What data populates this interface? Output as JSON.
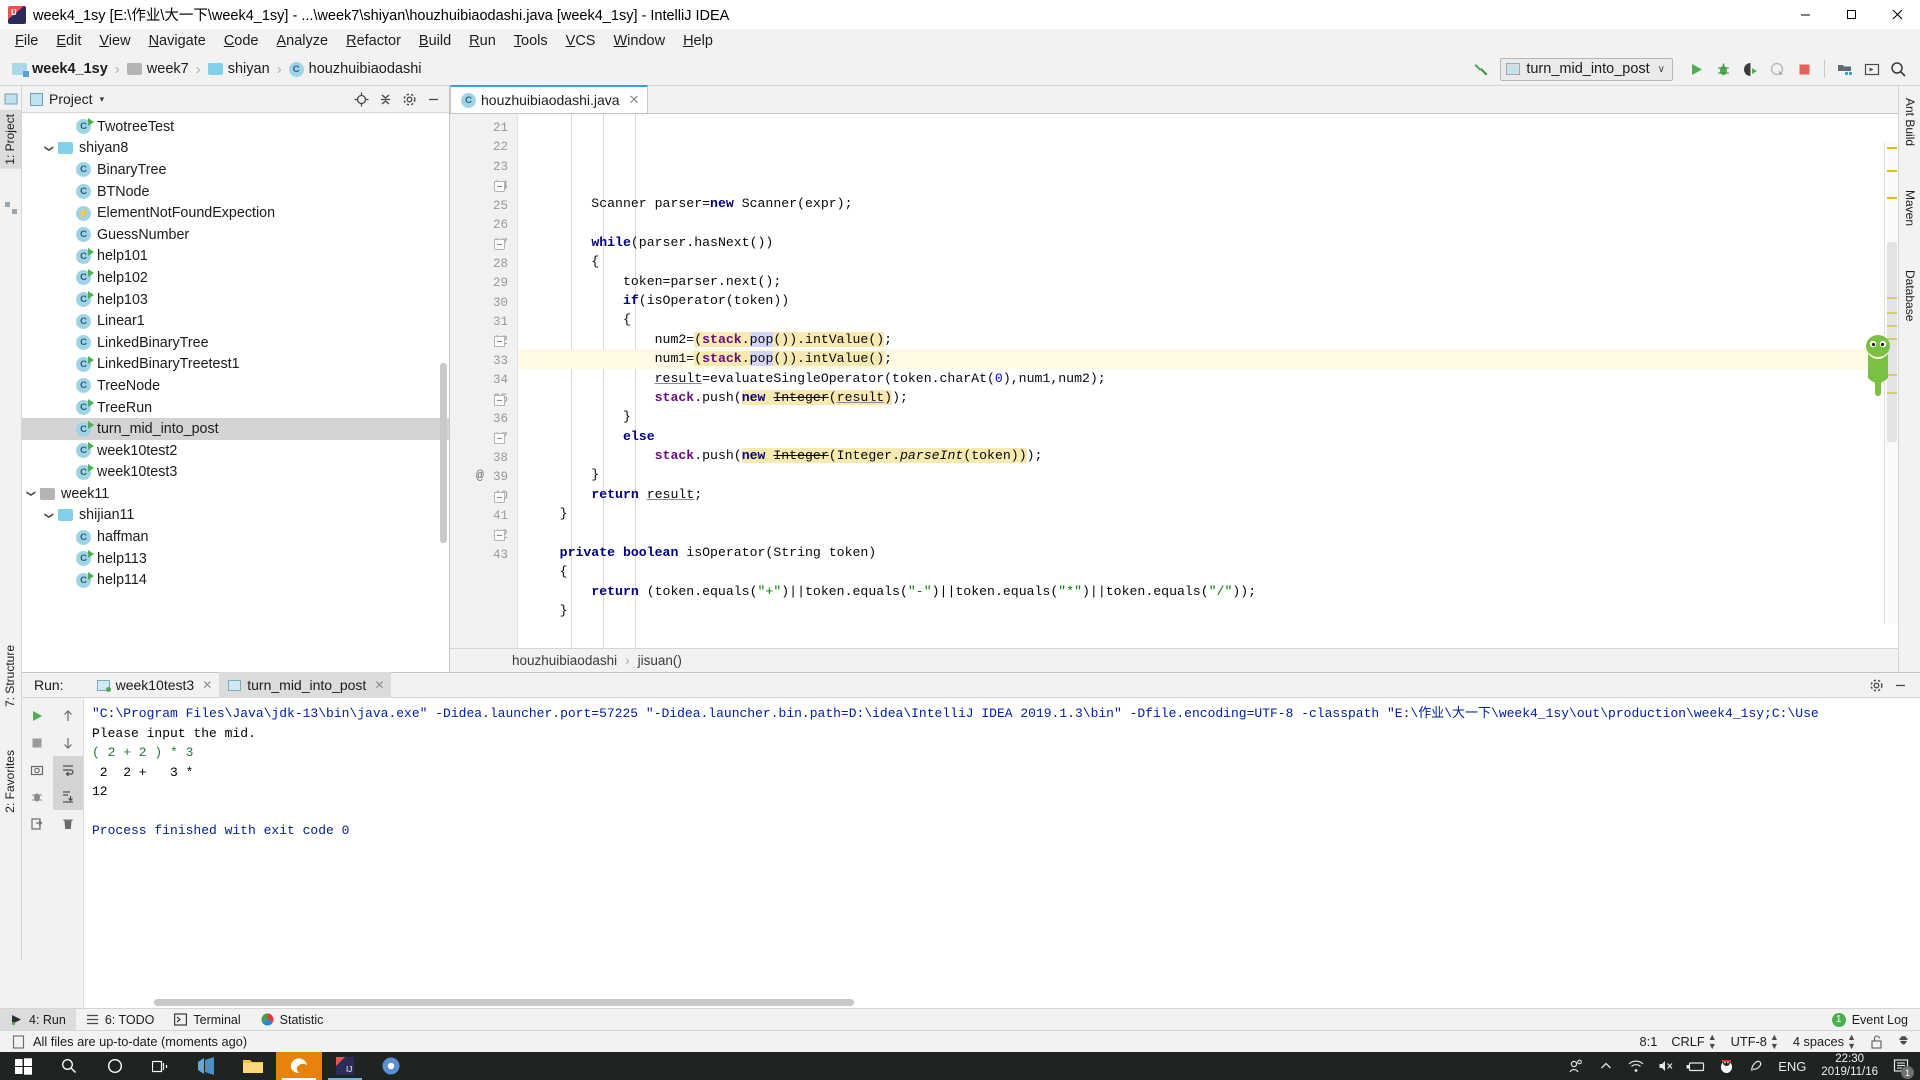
{
  "window": {
    "title": "week4_1sy [E:\\作业\\大一下\\week4_1sy] - ...\\week7\\shiyan\\houzhuibiaodashi.java [week4_1sy] - IntelliJ IDEA",
    "minimize_label": "—",
    "maximize_label": "☐",
    "close_label": "✕"
  },
  "menu": [
    {
      "label": "File"
    },
    {
      "label": "Edit"
    },
    {
      "label": "View"
    },
    {
      "label": "Navigate"
    },
    {
      "label": "Code"
    },
    {
      "label": "Analyze"
    },
    {
      "label": "Refactor"
    },
    {
      "label": "Build"
    },
    {
      "label": "Run"
    },
    {
      "label": "Tools"
    },
    {
      "label": "VCS"
    },
    {
      "label": "Window"
    },
    {
      "label": "Help"
    }
  ],
  "breadcrumbs": [
    {
      "label": "week4_1sy",
      "icon": "module-folder-icon",
      "bold": true
    },
    {
      "label": "week7",
      "icon": "folder-grey-icon",
      "bold": false
    },
    {
      "label": "shiyan",
      "icon": "folder-blue-icon",
      "bold": false
    },
    {
      "label": "houzhuibiaodashi",
      "icon": "java-class-icon",
      "bold": false
    }
  ],
  "toolbar": {
    "build_icon": "hammer-icon",
    "run_config": "turn_mid_into_post",
    "run_config_icon": "application-config-icon",
    "dropdown_arrow": "∨",
    "buttons": [
      {
        "name": "run-button",
        "icon": "play-icon"
      },
      {
        "name": "debug-button",
        "icon": "bug-icon"
      },
      {
        "name": "run-with-coverage-button",
        "icon": "coverage-icon"
      },
      {
        "name": "profile-button",
        "icon": "profile-icon"
      },
      {
        "name": "stop-button",
        "icon": "stop-square-icon"
      },
      {
        "name": "project-structure-button",
        "icon": "project-structure-icon"
      },
      {
        "name": "select-opened-file-button",
        "icon": "terminal-box-icon"
      },
      {
        "name": "search-everywhere-button",
        "icon": "search-icon"
      }
    ]
  },
  "left_strip": [
    {
      "label": "1: Project",
      "selected": true
    },
    {
      "label": "7: Structure",
      "selected": false
    },
    {
      "label": "2: Favorites",
      "selected": false
    }
  ],
  "right_strip": [
    {
      "label": "Ant Build"
    },
    {
      "label": "Maven"
    },
    {
      "label": "Database"
    }
  ],
  "project_panel": {
    "title": "Project",
    "caret": "▾",
    "actions": [
      "locate-icon",
      "collapse-all-icon",
      "settings-gear-icon",
      "hide-icon"
    ],
    "tree": [
      {
        "label": "TwotreeTest",
        "depth": 3,
        "icon": "class-runnable-icon",
        "twisty": "",
        "selected": false
      },
      {
        "label": "shiyan8",
        "depth": 2,
        "icon": "folder-blue-icon",
        "twisty": "v",
        "selected": false
      },
      {
        "label": "BinaryTree",
        "depth": 3,
        "icon": "class-icon",
        "twisty": "",
        "selected": false
      },
      {
        "label": "BTNode",
        "depth": 3,
        "icon": "class-icon",
        "twisty": "",
        "selected": false
      },
      {
        "label": "ElementNotFoundExpection",
        "depth": 3,
        "icon": "exception-class-icon",
        "twisty": "",
        "selected": false
      },
      {
        "label": "GuessNumber",
        "depth": 3,
        "icon": "class-icon",
        "twisty": "",
        "selected": false
      },
      {
        "label": "help101",
        "depth": 3,
        "icon": "class-runnable-icon",
        "twisty": "",
        "selected": false
      },
      {
        "label": "help102",
        "depth": 3,
        "icon": "class-runnable-icon",
        "twisty": "",
        "selected": false
      },
      {
        "label": "help103",
        "depth": 3,
        "icon": "class-runnable-icon",
        "twisty": "",
        "selected": false
      },
      {
        "label": "Linear1",
        "depth": 3,
        "icon": "class-icon",
        "twisty": "",
        "selected": false
      },
      {
        "label": "LinkedBinaryTree",
        "depth": 3,
        "icon": "class-icon",
        "twisty": "",
        "selected": false
      },
      {
        "label": "LinkedBinaryTreetest1",
        "depth": 3,
        "icon": "class-runnable-icon",
        "twisty": "",
        "selected": false
      },
      {
        "label": "TreeNode",
        "depth": 3,
        "icon": "class-icon",
        "twisty": "",
        "selected": false
      },
      {
        "label": "TreeRun",
        "depth": 3,
        "icon": "class-runnable-icon",
        "twisty": "",
        "selected": false
      },
      {
        "label": "turn_mid_into_post",
        "depth": 3,
        "icon": "class-runnable-icon",
        "twisty": "",
        "selected": true
      },
      {
        "label": "week10test2",
        "depth": 3,
        "icon": "class-runnable-icon",
        "twisty": "",
        "selected": false
      },
      {
        "label": "week10test3",
        "depth": 3,
        "icon": "class-runnable-icon",
        "twisty": "",
        "selected": false
      },
      {
        "label": "week11",
        "depth": 1,
        "icon": "folder-grey-icon",
        "twisty": "v",
        "selected": false
      },
      {
        "label": "shijian11",
        "depth": 2,
        "icon": "folder-blue-icon",
        "twisty": "v",
        "selected": false
      },
      {
        "label": "haffman",
        "depth": 3,
        "icon": "class-icon",
        "twisty": "",
        "selected": false
      },
      {
        "label": "help113",
        "depth": 3,
        "icon": "class-runnable-icon",
        "twisty": "",
        "selected": false
      },
      {
        "label": "help114",
        "depth": 3,
        "icon": "class-runnable-icon",
        "twisty": "",
        "selected": false
      }
    ]
  },
  "editor": {
    "tab": {
      "label": "houzhuibiaodashi.java",
      "icon": "java-class-icon",
      "close": "✕"
    },
    "first_line_number": 21,
    "current_line": 29,
    "lines": [
      {
        "n": 21,
        "html": "        Scanner parser=<span class=\"kw\">new</span> Scanner(expr);"
      },
      {
        "n": 22,
        "html": ""
      },
      {
        "n": 23,
        "html": "        <span class=\"kw\">while</span>(parser.hasNext())"
      },
      {
        "n": 24,
        "html": "        {",
        "fold": "down"
      },
      {
        "n": 25,
        "html": "            token=parser.next();"
      },
      {
        "n": 26,
        "html": "            <span class=\"kw\">if</span>(isOperator(token))"
      },
      {
        "n": 27,
        "html": "            {",
        "fold": "down"
      },
      {
        "n": 28,
        "html": "                num2=<span class=\"hl\">(<span class=\"fld\">stack</span>.</span><span class=\"hl2\">pop</span><span class=\"hl\">()).intValue()</span>;"
      },
      {
        "n": 29,
        "html": "                num1=<span class=\"hl\">(<span class=\"fld\">stack</span>.</span><span class=\"hl2\">pop</span><span class=\"hl\">()).intValue()</span>;"
      },
      {
        "n": 30,
        "html": "                <span class=\"und\">result</span>=evaluateSingleOperator(token.charAt(<span class=\"num\">0</span>),num1,num2);"
      },
      {
        "n": 31,
        "html": "                <span class=\"fld\">stack</span>.push(<span class=\"hl\"><span class=\"kw\">new</span> <span class=\"strike\">Integer</span>(<span class=\"und\">result</span>)</span>);"
      },
      {
        "n": 32,
        "html": "            }",
        "fold": "up"
      },
      {
        "n": 33,
        "html": "            <span class=\"kw\">else</span>"
      },
      {
        "n": 34,
        "html": "                <span class=\"fld\">stack</span>.push(<span class=\"hl\"><span class=\"kw\">new</span> <span class=\"strike\">Integer</span>(Integer.<span class=\"ital\">parseInt</span>(token))</span>);"
      },
      {
        "n": 35,
        "html": "        }",
        "fold": "up"
      },
      {
        "n": 36,
        "html": "        <span class=\"kw\">return</span> <span class=\"und\">result</span>;"
      },
      {
        "n": 37,
        "html": "    }",
        "fold": "up"
      },
      {
        "n": 38,
        "html": ""
      },
      {
        "n": 39,
        "html": "    <span class=\"kw\">private boolean</span> isOperator(String token)",
        "at": true
      },
      {
        "n": 40,
        "html": "    {",
        "fold": "down"
      },
      {
        "n": 41,
        "html": "        <span class=\"kw\">return</span> (token.equals(<span class=\"str\">\"+\"</span>)||token.equals(<span class=\"str\">\"-\"</span>)||token.equals(<span class=\"str\">\"*\"</span>)||token.equals(<span class=\"str\">\"/\"</span>));"
      },
      {
        "n": 42,
        "html": "    }",
        "fold": "up"
      },
      {
        "n": 43,
        "html": ""
      }
    ],
    "status_breadcrumb": [
      "houzhuibiaodashi",
      "jisuan()"
    ],
    "breadcrumb_sep": "›"
  },
  "run_panel": {
    "label": "Run:",
    "tabs": [
      {
        "label": "week10test3",
        "active": false,
        "close": "✕",
        "running": true
      },
      {
        "label": "turn_mid_into_post",
        "active": true,
        "close": "✕",
        "running": false
      }
    ],
    "toolbar": [
      {
        "name": "rerun-button",
        "icon": "play-green-icon"
      },
      {
        "name": "scroll-up-button",
        "icon": "arrow-up-icon"
      },
      {
        "name": "stop-button",
        "icon": "stop-square-icon"
      },
      {
        "name": "scroll-down-button",
        "icon": "arrow-down-icon"
      },
      {
        "name": "print-button",
        "icon": "camera-icon"
      },
      {
        "name": "soft-wrap-button",
        "icon": "wrap-icon"
      },
      {
        "name": "thread-dump-button",
        "icon": "thread-dump-icon"
      },
      {
        "name": "scroll-to-end-button",
        "icon": "scroll-end-icon"
      },
      {
        "name": "export-button",
        "icon": "export-icon"
      },
      {
        "name": "trash-button",
        "icon": "trash-icon"
      }
    ],
    "settings_icon": "gear-icon",
    "hide_icon": "minimize-icon",
    "console": [
      {
        "text": "\"C:\\Program Files\\Java\\jdk-13\\bin\\java.exe\" -Didea.launcher.port=57225 \"-Didea.launcher.bin.path=D:\\idea\\IntelliJ IDEA 2019.1.3\\bin\" -Dfile.encoding=UTF-8 -classpath \"E:\\作业\\大一下\\week4_1sy\\out\\production\\week4_1sy;C:\\Use",
        "style": "cmd"
      },
      {
        "text": "Please input the mid.",
        "style": "plain"
      },
      {
        "text": "( 2 + 2 ) * 3",
        "style": "green"
      },
      {
        "text": " 2  2 +   3 *",
        "style": "plain"
      },
      {
        "text": "12",
        "style": "plain"
      },
      {
        "text": "",
        "style": "plain"
      },
      {
        "text": "Process finished with exit code 0",
        "style": "cmd"
      }
    ]
  },
  "bottom_strip": {
    "items": [
      {
        "label": "4: Run",
        "icon": "run-icon",
        "active": true
      },
      {
        "label": "6: TODO",
        "icon": "todo-icon",
        "active": false
      },
      {
        "label": "Terminal",
        "icon": "terminal-icon",
        "active": false
      },
      {
        "label": "Statistic",
        "icon": "statistic-icon",
        "active": false
      }
    ],
    "event_log": {
      "label": "Event Log",
      "count": "1"
    }
  },
  "status_bar": {
    "message": "All files are up-to-date (moments ago)",
    "message_icon": "document-icon",
    "caret": "8:1",
    "line_sep": "CRLF",
    "encoding": "UTF-8",
    "indent": "4 spaces",
    "lock_icon": "unlocked-icon",
    "inspector_icon": "hector-icon"
  },
  "taskbar": {
    "items": [
      {
        "name": "start-button",
        "icon": "windows-logo-icon"
      },
      {
        "name": "search-button",
        "icon": "search-icon"
      },
      {
        "name": "cortana-button",
        "icon": "circle-icon"
      },
      {
        "name": "task-view-button",
        "icon": "task-view-icon"
      },
      {
        "name": "app-vscode",
        "icon": "vscode-icon"
      },
      {
        "name": "app-explorer",
        "icon": "folder-icon"
      },
      {
        "name": "app-edge",
        "icon": "edge-icon"
      },
      {
        "name": "app-intellij",
        "icon": "intellij-icon"
      },
      {
        "name": "app-browser",
        "icon": "browser-icon"
      }
    ],
    "tray": [
      {
        "name": "people-icon",
        "glyph": "⚹"
      },
      {
        "name": "show-hidden-icons",
        "glyph": "⌃"
      },
      {
        "name": "network-icon",
        "glyph": "◔"
      },
      {
        "name": "volume-muted-icon",
        "glyph": "⏷"
      },
      {
        "name": "battery-icon",
        "glyph": "▬"
      },
      {
        "name": "qq-icon",
        "glyph": "●"
      },
      {
        "name": "pen-icon",
        "glyph": "✒"
      }
    ],
    "language": "ENG",
    "time": "22:30",
    "date": "2019/11/16",
    "notification_count": "1"
  },
  "colors": {
    "accent": "#3f9ee0",
    "selection": "#d4d4d4",
    "current_line": "#fffae3",
    "keyword": "#000080",
    "string": "#008000",
    "field": "#660e7a",
    "console_cmd": "#00209f",
    "taskbar_bg": "#1f2421"
  }
}
